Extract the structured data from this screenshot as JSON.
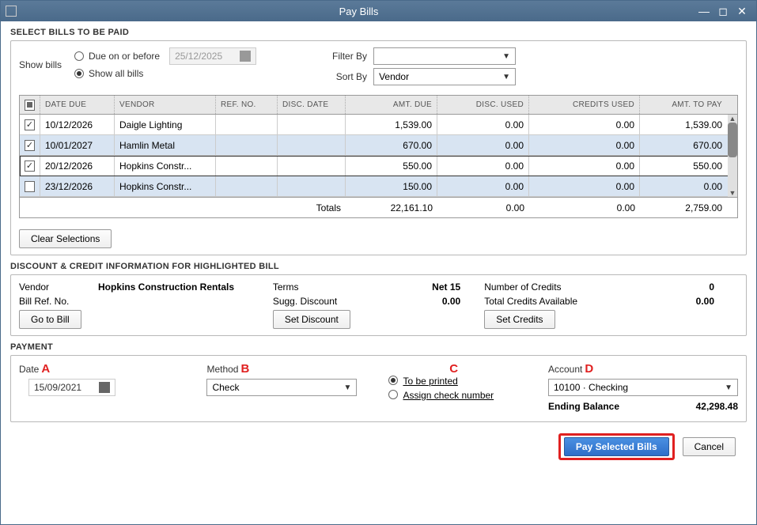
{
  "titlebar": {
    "title": "Pay Bills"
  },
  "select": {
    "header": "SELECT BILLS TO BE PAID",
    "show_bills_label": "Show bills",
    "radio_due": "Due on or before",
    "radio_all": "Show all bills",
    "due_date": "25/12/2025",
    "filter_by_label": "Filter By",
    "filter_by_value": "",
    "sort_by_label": "Sort By",
    "sort_by_value": "Vendor"
  },
  "table": {
    "headers": {
      "date_due": "DATE DUE",
      "vendor": "VENDOR",
      "ref_no": "REF. NO.",
      "disc_date": "DISC. DATE",
      "amt_due": "AMT. DUE",
      "disc_used": "DISC. USED",
      "credits_used": "CREDITS USED",
      "amt_pay": "AMT. TO PAY"
    },
    "rows": [
      {
        "checked": true,
        "date_due": "10/12/2026",
        "vendor": "Daigle Lighting",
        "ref_no": "",
        "disc_date": "",
        "amt_due": "1,539.00",
        "disc_used": "0.00",
        "credits_used": "0.00",
        "amt_pay": "1,539.00",
        "alt": false
      },
      {
        "checked": true,
        "date_due": "10/01/2027",
        "vendor": "Hamlin Metal",
        "ref_no": "",
        "disc_date": "",
        "amt_due": "670.00",
        "disc_used": "0.00",
        "credits_used": "0.00",
        "amt_pay": "670.00",
        "alt": true
      },
      {
        "checked": true,
        "date_due": "20/12/2026",
        "vendor": "Hopkins Constr...",
        "ref_no": "",
        "disc_date": "",
        "amt_due": "550.00",
        "disc_used": "0.00",
        "credits_used": "0.00",
        "amt_pay": "550.00",
        "alt": false,
        "hl": true
      },
      {
        "checked": false,
        "date_due": "23/12/2026",
        "vendor": "Hopkins Constr...",
        "ref_no": "",
        "disc_date": "",
        "amt_due": "150.00",
        "disc_used": "0.00",
        "credits_used": "0.00",
        "amt_pay": "0.00",
        "alt": true
      }
    ],
    "totals": {
      "label": "Totals",
      "amt_due": "22,161.10",
      "disc_used": "0.00",
      "credits_used": "0.00",
      "amt_pay": "2,759.00"
    }
  },
  "clear_btn": "Clear Selections",
  "disc": {
    "header": "DISCOUNT & CREDIT INFORMATION FOR HIGHLIGHTED BILL",
    "vendor_l": "Vendor",
    "vendor_v": "Hopkins Construction Rentals",
    "ref_l": "Bill Ref. No.",
    "ref_v": "",
    "terms_l": "Terms",
    "terms_v": "Net 15",
    "sugg_l": "Sugg. Discount",
    "sugg_v": "0.00",
    "numcred_l": "Number of Credits",
    "numcred_v": "0",
    "totcred_l": "Total Credits Available",
    "totcred_v": "0.00",
    "goto_btn": "Go to Bill",
    "setdisc_btn": "Set Discount",
    "setcred_btn": "Set Credits"
  },
  "pay": {
    "header": "PAYMENT",
    "date_l": "Date",
    "date_v": "15/09/2021",
    "method_l": "Method",
    "method_v": "Check",
    "radio_print": "To be printed",
    "radio_assign": "Assign check number",
    "account_l": "Account",
    "account_v": "10100 · Checking",
    "ending_l": "Ending Balance",
    "ending_v": "42,298.48",
    "A": "A",
    "B": "B",
    "C": "C",
    "D": "D"
  },
  "footer": {
    "pay": "Pay Selected Bills",
    "cancel": "Cancel"
  }
}
